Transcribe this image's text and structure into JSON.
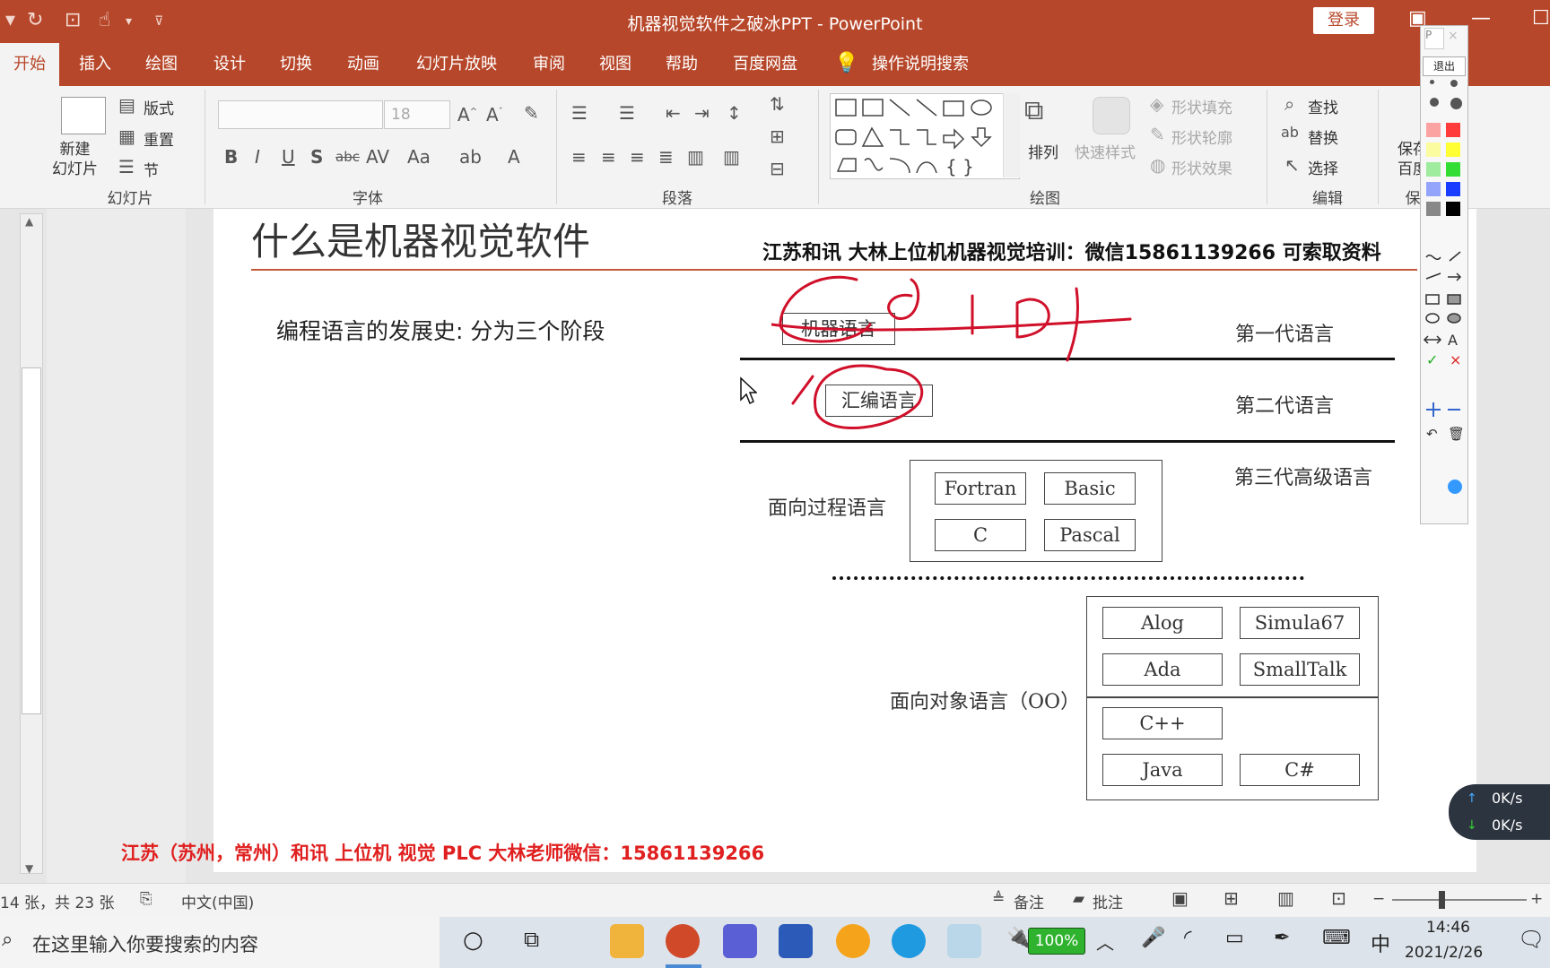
{
  "window": {
    "doc_title": "机器视觉软件之破冰PPT  -  PowerPoint",
    "login_label": "登录"
  },
  "tabs": [
    "开始",
    "插入",
    "绘图",
    "设计",
    "切换",
    "动画",
    "幻灯片放映",
    "审阅",
    "视图",
    "帮助",
    "百度网盘",
    "操作说明搜索"
  ],
  "ribbon": {
    "slides_group": {
      "new_slide": "新建\n幻灯片",
      "layout": "版式",
      "reset": "重置",
      "section": "节",
      "label": "幻灯片"
    },
    "font_group": {
      "font_size": "18",
      "label": "字体"
    },
    "paragraph_group": {
      "label": "段落"
    },
    "drawing_group": {
      "arrange": "排列",
      "quick_styles": "快速样式",
      "shape_fill": "形状填充",
      "shape_outline": "形状轮廓",
      "shape_effects": "形状效果",
      "label": "绘图"
    },
    "editing_group": {
      "find": "查找",
      "replace": "替换",
      "select": "选择",
      "label": "编辑"
    },
    "baidu_group": {
      "line1": "保存",
      "line2": "百度",
      "label": "保"
    }
  },
  "pen_toolbar": {
    "exit_label": "退出",
    "colors": [
      "#ff3b3b",
      "#ffff33",
      "#33dd33",
      "#1a3cff",
      "#000000"
    ]
  },
  "slide": {
    "title": "什么是机器视觉软件",
    "banner": "江苏和讯   大林上位机机器视觉培训：微信15861139266 可索取资料",
    "subtitle": "编程语言的发展史: 分为三个阶段",
    "footer": "江苏（苏州，常州）和讯 上位机  视觉  PLC 大林老师微信：15861139266",
    "diagram": {
      "gen1": {
        "box": "机器语言",
        "label": "第一代语言"
      },
      "gen2": {
        "box": "汇编语言",
        "label": "第二代语言"
      },
      "gen3_label": "第三代高级语言",
      "procedural": {
        "label": "面向过程语言",
        "langs": [
          "Fortran",
          "Basic",
          "C",
          "Pascal"
        ]
      },
      "oo": {
        "label": "面向对象语言（OO）",
        "langs": [
          "Alog",
          "Simula67",
          "Ada",
          "SmallTalk",
          "C++",
          "Java",
          "C#"
        ]
      },
      "handwriting": "0101"
    }
  },
  "statusbar": {
    "slide_count": "14 张，共 23 张",
    "language": "中文(中国)",
    "notes": "备注",
    "comments": "批注"
  },
  "taskbar": {
    "search_placeholder": "在这里输入你要搜索的内容",
    "battery": "100%",
    "ime": "中",
    "time": "14:46",
    "date": "2021/2/26"
  },
  "netmon": {
    "up": "0K/s",
    "down": "0K/s"
  }
}
